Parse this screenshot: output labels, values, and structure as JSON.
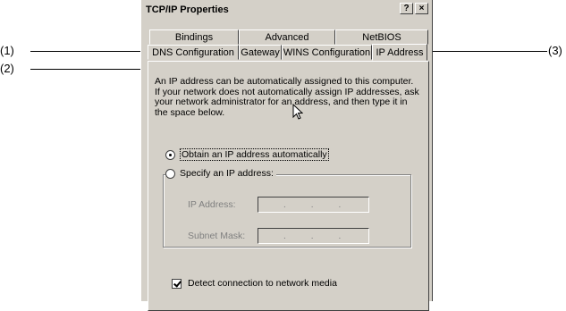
{
  "callouts": [
    "(1)",
    "(2)",
    "(3)"
  ],
  "dialog": {
    "title": "TCP/IP Properties",
    "buttons": {
      "help": "?",
      "close": "×"
    }
  },
  "tabs": {
    "row1": [
      "Bindings",
      "Advanced",
      "NetBIOS"
    ],
    "row2": [
      "DNS Configuration",
      "Gateway",
      "WINS Configuration",
      "IP Address"
    ],
    "selected": "IP Address"
  },
  "panel": {
    "description": "An IP address can be automatically assigned to this computer.\nIf your network does not automatically assign IP addresses, ask\nyour network administrator for an address, and then type it in\nthe space below.",
    "obtain_label": "Obtain an IP address automatically",
    "specify_label": "Specify an IP address:",
    "ip_label": "IP Address:",
    "mask_label": "Subnet Mask:",
    "ip_dots": [
      ".",
      ".",
      "."
    ],
    "mask_dots": [
      ".",
      ".",
      "."
    ],
    "detect_label": "Detect connection to network media",
    "obtain_selected": true,
    "detect_checked": true
  },
  "icons": {
    "cursor": "arrow-cursor-icon"
  }
}
